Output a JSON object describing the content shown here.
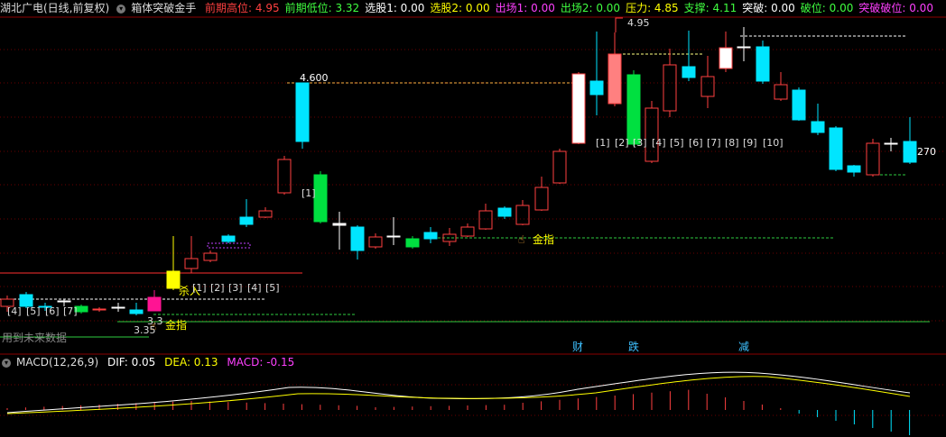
{
  "header": {
    "stock": "湖北广电(日线,前复权)",
    "indicator": "箱体突破金手",
    "items": [
      {
        "label": "前期高位: 4.95",
        "color": "#ff4040"
      },
      {
        "label": "前期低位: 3.32",
        "color": "#40ff40"
      },
      {
        "label": "选股1: 0.00",
        "color": "#ffffff"
      },
      {
        "label": "选股2: 0.00",
        "color": "#ffff00"
      },
      {
        "label": "出场1: 0.00",
        "color": "#ff40ff"
      },
      {
        "label": "出场2: 0.00",
        "color": "#40ff40"
      },
      {
        "label": "压力: 4.85",
        "color": "#ffff00"
      },
      {
        "label": "支撑: 4.11",
        "color": "#40ff40"
      },
      {
        "label": "突破: 0.00",
        "color": "#ffffff"
      },
      {
        "label": "破位: 0.00",
        "color": "#40ff40"
      },
      {
        "label": "突破破位: 0.00",
        "color": "#ff40ff"
      }
    ]
  },
  "annotations": {
    "price_4600": "4.600",
    "price_495": "4.95",
    "price_335": "3.35",
    "price_331": "3.3",
    "price_27": "270",
    "gold_finger_1": "金指",
    "gold_finger_2": "金指",
    "kill": "杀入",
    "future_data": "用到未来数据",
    "cai": "财",
    "die": "跌",
    "jian": "减"
  },
  "counters_left": [
    "[4]",
    "[5]",
    "[6]",
    "[7]"
  ],
  "counters_mid": [
    "[1]",
    "[2]",
    "[3]",
    "[4]",
    "[5]"
  ],
  "counters_box": [
    "[1]"
  ],
  "counters_right": [
    "[1]",
    "[2]",
    "[3]",
    "[4]",
    "[5]",
    "[6]",
    "[7]",
    "[8]",
    "[9]",
    "[10]"
  ],
  "macd": {
    "title": "MACD(12,26,9)",
    "dif": "DIF: 0.05",
    "dea": "DEA: 0.13",
    "macd": "MACD: -0.15"
  },
  "colors": {
    "up": "#ff4040",
    "down": "#00e5ff",
    "bg": "#000000",
    "grid": "#8b0000"
  }
}
